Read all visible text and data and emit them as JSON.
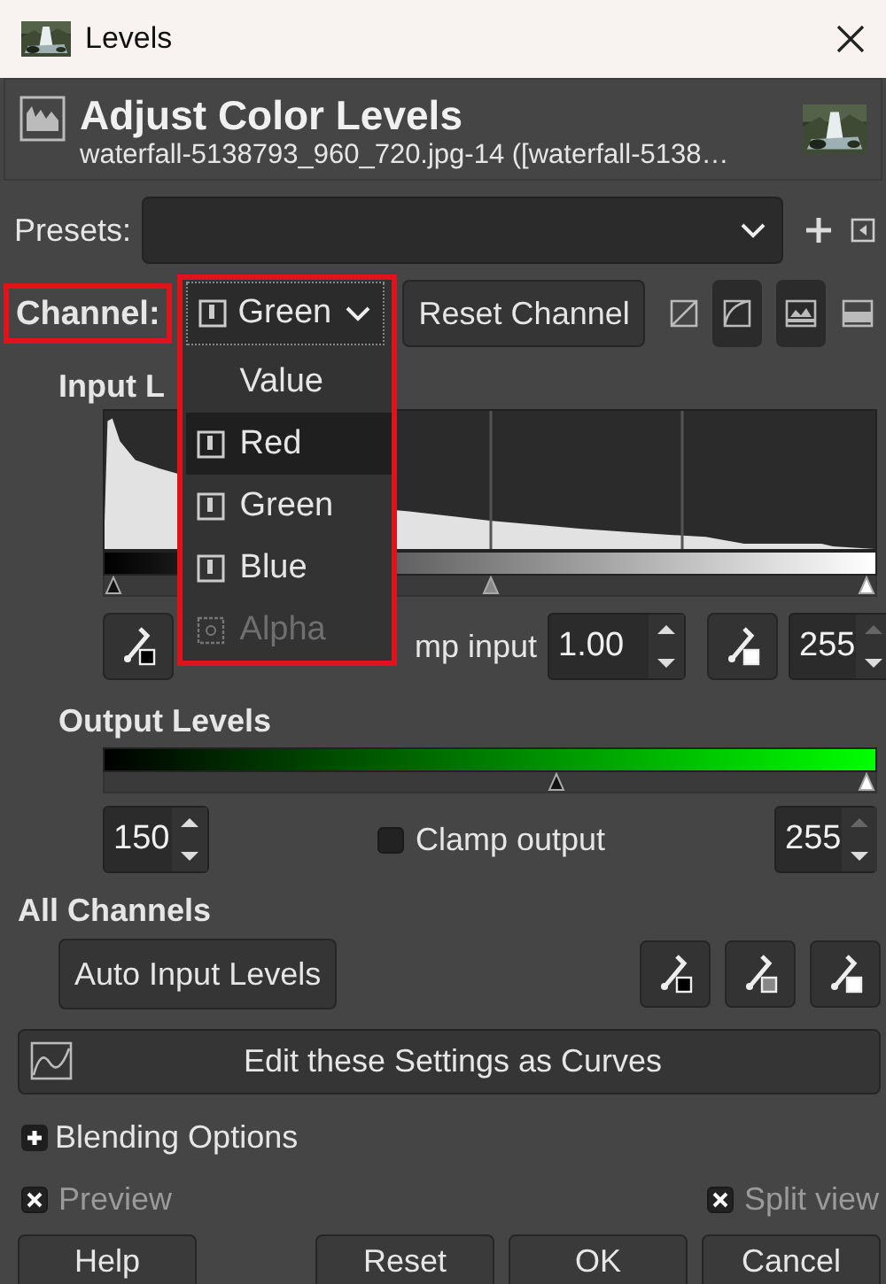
{
  "window": {
    "title": "Levels"
  },
  "header": {
    "title": "Adjust Color Levels",
    "subtitle": "waterfall-5138793_960_720.jpg-14 ([waterfall-5138…"
  },
  "presets": {
    "label": "Presets:"
  },
  "channel": {
    "label": "Channel:",
    "value": "Green",
    "reset_button": "Reset Channel",
    "scale_buttons": [
      {
        "kind": "linear",
        "selected": false
      },
      {
        "kind": "log",
        "selected": true
      }
    ],
    "view_buttons": [
      {
        "kind": "bars",
        "selected": true
      },
      {
        "kind": "filled",
        "selected": false
      }
    ]
  },
  "channel_menu": [
    {
      "label": "Value",
      "kind": "plain",
      "selected": false,
      "disabled": false
    },
    {
      "label": "Red",
      "kind": "channel",
      "selected": true,
      "disabled": false
    },
    {
      "label": "Green",
      "kind": "channel",
      "selected": false,
      "disabled": false
    },
    {
      "label": "Blue",
      "kind": "channel",
      "selected": false,
      "disabled": false
    },
    {
      "label": "Alpha",
      "kind": "alpha",
      "selected": false,
      "disabled": true
    }
  ],
  "input_levels": {
    "label": "Input L",
    "markers": [
      {
        "kind": "black",
        "level": 0
      },
      {
        "kind": "gray",
        "level": 0.5
      },
      {
        "kind": "white",
        "level": 1
      }
    ],
    "clamp_label": "mp input",
    "gamma": {
      "value": "1.00",
      "at_max": false
    },
    "high": {
      "value": "255",
      "at_max": true
    }
  },
  "output_levels": {
    "label": "Output Levels",
    "markers": [
      {
        "kind": "black",
        "level": 0.588
      },
      {
        "kind": "white",
        "level": 1
      }
    ],
    "low": {
      "value": "150",
      "at_max": false
    },
    "clamp_label": "Clamp output",
    "clamp_checked": false,
    "high": {
      "value": "255",
      "at_max": true
    }
  },
  "all_channels": {
    "label": "All Channels",
    "auto_button": "Auto Input Levels"
  },
  "curves_button": "Edit these Settings as Curves",
  "blending": {
    "label": "Blending Options",
    "expanded": false
  },
  "options": [
    {
      "label": "Preview",
      "checked": true,
      "disabled": true
    },
    {
      "label": "Split view",
      "checked": true,
      "disabled": true
    }
  ],
  "buttons": [
    {
      "label": "Help"
    },
    {
      "label": "Reset"
    },
    {
      "label": "OK"
    },
    {
      "label": "Cancel"
    }
  ]
}
